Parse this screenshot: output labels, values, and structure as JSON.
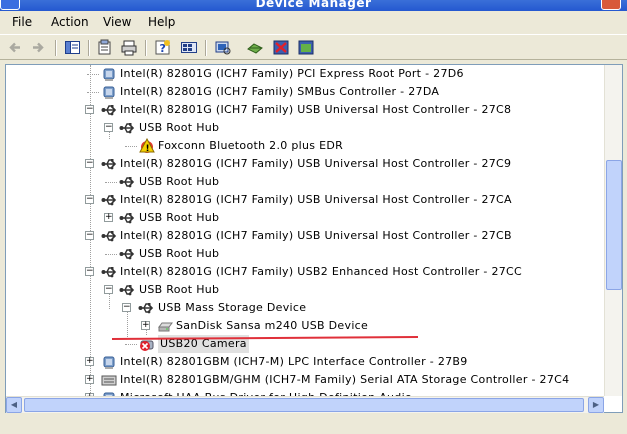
{
  "window": {
    "title": "Device Manager"
  },
  "menu": [
    {
      "label": "File"
    },
    {
      "label": "Action"
    },
    {
      "label": "View"
    },
    {
      "label": "Help"
    }
  ],
  "toolbar": [
    {
      "icon": "back-arrow-icon"
    },
    {
      "icon": "forward-arrow-icon"
    },
    {
      "icon": "show-hide-tree-icon"
    },
    {
      "icon": "properties-icon"
    },
    {
      "icon": "print-icon"
    },
    {
      "icon": "help-icon"
    },
    {
      "icon": "view-devices-icon"
    },
    {
      "icon": "scan-hardware-icon"
    },
    {
      "icon": "update-driver-icon"
    },
    {
      "icon": "uninstall-icon"
    },
    {
      "icon": "enable-device-icon"
    }
  ],
  "tree": [
    {
      "label": "Intel(R) 82801G (ICH7 Family) PCI Express Root Port - 27D6",
      "icon": "pci-device-icon"
    },
    {
      "label": "Intel(R) 82801G (ICH7 Family) SMBus Controller - 27DA",
      "icon": "pci-device-icon"
    },
    {
      "label": "Intel(R) 82801G (ICH7 Family) USB Universal Host Controller - 27C8",
      "icon": "usb-icon",
      "expander": "minus"
    },
    {
      "label": "USB Root Hub",
      "icon": "usb-icon",
      "expander": "minus"
    },
    {
      "label": "Foxconn Bluetooth 2.0 plus EDR",
      "icon": "warning-device-icon"
    },
    {
      "label": "Intel(R) 82801G (ICH7 Family) USB Universal Host Controller - 27C9",
      "icon": "usb-icon",
      "expander": "minus"
    },
    {
      "label": "USB Root Hub",
      "icon": "usb-icon"
    },
    {
      "label": "Intel(R) 82801G (ICH7 Family) USB Universal Host Controller - 27CA",
      "icon": "usb-icon",
      "expander": "minus"
    },
    {
      "label": "USB Root Hub",
      "icon": "usb-icon",
      "expander": "plus"
    },
    {
      "label": "Intel(R) 82801G (ICH7 Family) USB Universal Host Controller - 27CB",
      "icon": "usb-icon",
      "expander": "minus"
    },
    {
      "label": "USB Root Hub",
      "icon": "usb-icon"
    },
    {
      "label": "Intel(R) 82801G (ICH7 Family) USB2 Enhanced Host Controller - 27CC",
      "icon": "usb-icon",
      "expander": "minus"
    },
    {
      "label": "USB Root Hub",
      "icon": "usb-icon",
      "expander": "minus"
    },
    {
      "label": "USB Mass Storage Device",
      "icon": "usb-icon",
      "expander": "minus"
    },
    {
      "label": "SanDisk Sansa m240 USB Device",
      "icon": "disk-drive-icon",
      "expander": "plus"
    },
    {
      "label": "USB20 Camera",
      "icon": "disabled-camera-icon",
      "selected": true
    },
    {
      "label": "Intel(R) 82801GBM (ICH7-M) LPC Interface Controller - 27B9",
      "icon": "pci-device-icon",
      "expander": "plus"
    },
    {
      "label": "Intel(R) 82801GBM/GHM (ICH7-M Family) Serial ATA Storage Controller - 27C4",
      "icon": "ide-controller-icon",
      "expander": "plus"
    },
    {
      "label": "Microsoft UAA Bus Driver for High Definition Audio",
      "icon": "pci-device-icon",
      "expander": "plus"
    }
  ],
  "annotation_color": "#e0303a"
}
